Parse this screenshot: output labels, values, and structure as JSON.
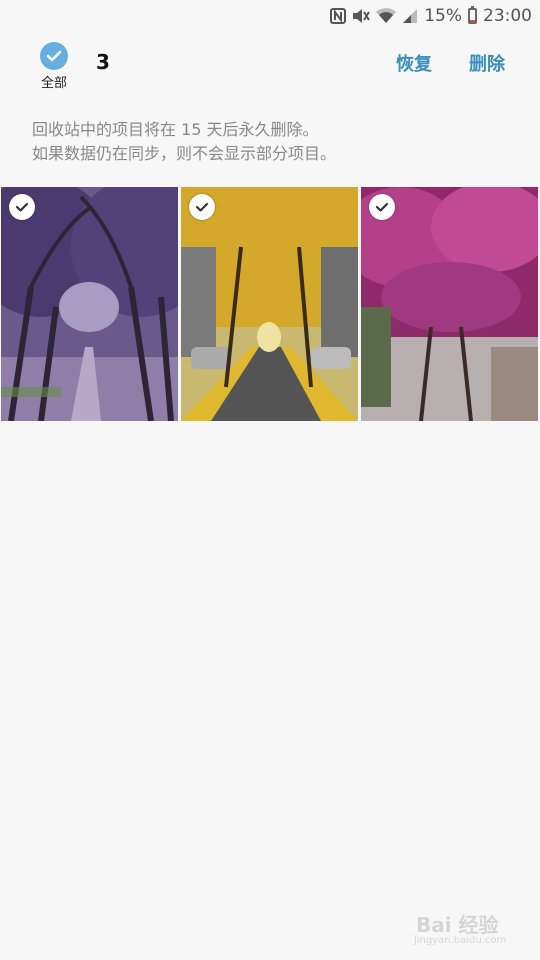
{
  "status_bar": {
    "battery_percent": "15%",
    "time": "23:00",
    "icons": [
      "nfc-icon",
      "mute-icon",
      "wifi-icon",
      "signal-icon",
      "battery-icon"
    ],
    "battery_level": 0.15,
    "battery_color": "#e74c3c"
  },
  "action_bar": {
    "select_all_label": "全部",
    "selected_count": "3",
    "restore_label": "恢复",
    "delete_label": "删除",
    "accent_color": "#3a8fbd",
    "check_color": "#67aee0"
  },
  "notice": {
    "line1": "回收站中的项目将在 15 天后永久删除。",
    "line2": "如果数据仍在同步，则不会显示部分项目。"
  },
  "photos": [
    {
      "description_icon": "purple-jacaranda-tree-tunnel",
      "selected": true
    },
    {
      "description_icon": "yellow-ginkgo-street",
      "selected": true
    },
    {
      "description_icon": "pink-flower-tree-canopy",
      "selected": true
    }
  ],
  "watermark": {
    "text": "Bai 经验",
    "sub": "jingyan.baidu.com"
  }
}
